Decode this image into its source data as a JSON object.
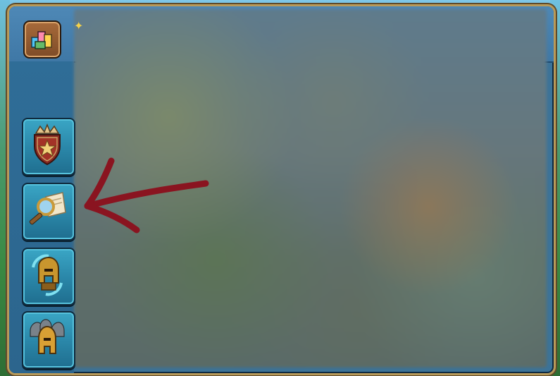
{
  "header": {
    "glyph": "✦"
  },
  "buttons": {
    "top": {
      "icon": "stats-blocks-icon"
    },
    "side": [
      {
        "icon": "crown-shield-star-icon"
      },
      {
        "icon": "magnifying-glass-scroll-icon"
      },
      {
        "icon": "helmet-swap-icon"
      },
      {
        "icon": "troops-helmets-icon"
      }
    ]
  },
  "annotation": {
    "icon": "red-arrow-icon",
    "color": "#8a1420"
  },
  "colors": {
    "frame_gold": "#b89a5a",
    "panel_blue": "#3b7399",
    "button_teal": "#2b88aa"
  }
}
